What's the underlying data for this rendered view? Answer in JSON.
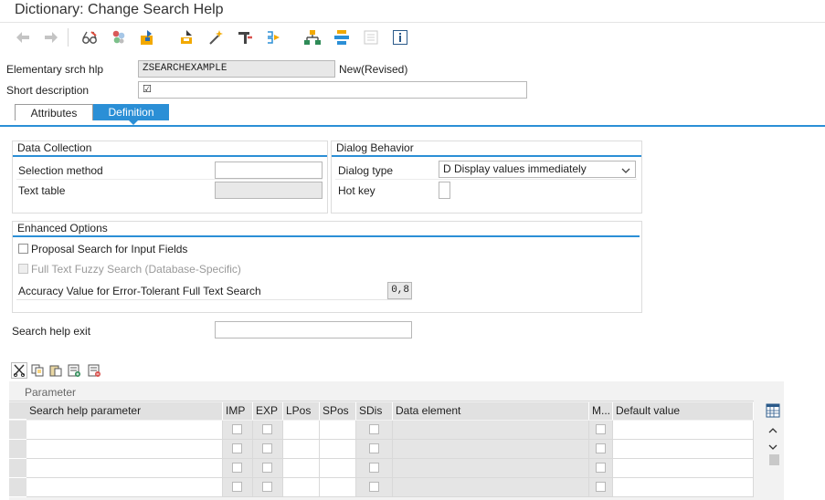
{
  "window": {
    "title": "Dictionary: Change Search Help"
  },
  "toolbar": {
    "icons": [
      "back-arrow-icon",
      "forward-arrow-icon",
      "display-change-glasses-icon",
      "other-object-icon",
      "activate-icon",
      "check-object-icon",
      "where-used-icon",
      "magic-wand-icon",
      "transport-icon",
      "navigate-icon",
      "hierarchy-icon",
      "object-list-icon",
      "documentation-icon",
      "info-icon"
    ]
  },
  "header": {
    "search_help_label": "Elementary srch hlp",
    "search_help_value": "ZSEARCHEXAMPLE",
    "status": "New(Revised)",
    "short_desc_label": "Short description",
    "short_desc_value": "☑"
  },
  "tabs": [
    {
      "label": "Attributes",
      "active": false
    },
    {
      "label": "Definition",
      "active": true
    }
  ],
  "data_collection": {
    "title": "Data Collection",
    "selection_method_label": "Selection method",
    "selection_method_value": "",
    "text_table_label": "Text table",
    "text_table_value": ""
  },
  "dialog_behavior": {
    "title": "Dialog Behavior",
    "dialog_type_label": "Dialog type",
    "dialog_type_value": "D Display values immediately",
    "hot_key_label": "Hot key",
    "hot_key_value": ""
  },
  "enhanced_options": {
    "title": "Enhanced Options",
    "proposal_search_label": "Proposal Search for Input Fields",
    "fuzzy_search_label": "Full Text Fuzzy Search (Database-Specific)",
    "accuracy_label": "Accuracy Value for Error-Tolerant Full Text Search",
    "accuracy_value": "0,8"
  },
  "exit": {
    "label": "Search help exit",
    "value": ""
  },
  "table_toolbar": {
    "icons": [
      "cut-icon",
      "copy-icon",
      "paste-icon",
      "insert-row-icon",
      "delete-row-icon"
    ]
  },
  "parameter_table": {
    "section_label": "Parameter",
    "columns": [
      "Search help parameter",
      "IMP",
      "EXP",
      "LPos",
      "SPos",
      "SDis",
      "Data element",
      "M...",
      "Default value"
    ],
    "row_count": 4
  },
  "colors": {
    "accent": "#2b8fd6",
    "header_bg": "#e1e1e1",
    "readonly_bg": "#e8e8e8"
  }
}
